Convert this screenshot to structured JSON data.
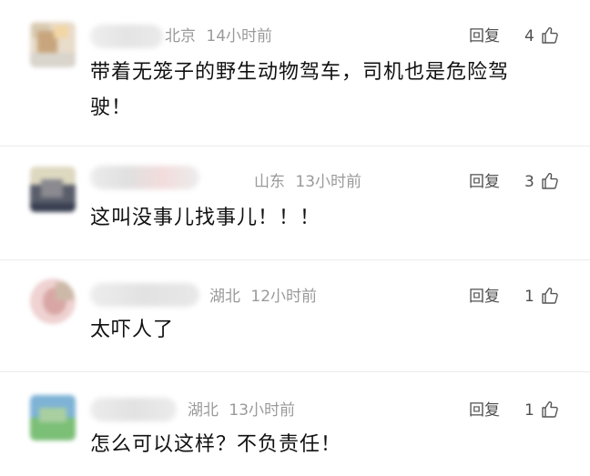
{
  "comments": [
    {
      "location": "北京",
      "time": "14小时前",
      "reply": "回复",
      "likes": "4",
      "text": "带着无笼子的野生动物驾车，司机也是危险驾驶！"
    },
    {
      "location": "山东",
      "time": "13小时前",
      "reply": "回复",
      "likes": "3",
      "text": "这叫没事儿找事儿！！！"
    },
    {
      "location": "湖北",
      "time": "12小时前",
      "reply": "回复",
      "likes": "1",
      "text": "太吓人了"
    },
    {
      "location": "湖北",
      "time": "13小时前",
      "reply": "回复",
      "likes": "1",
      "text": "怎么可以这样？不负责任！"
    }
  ]
}
